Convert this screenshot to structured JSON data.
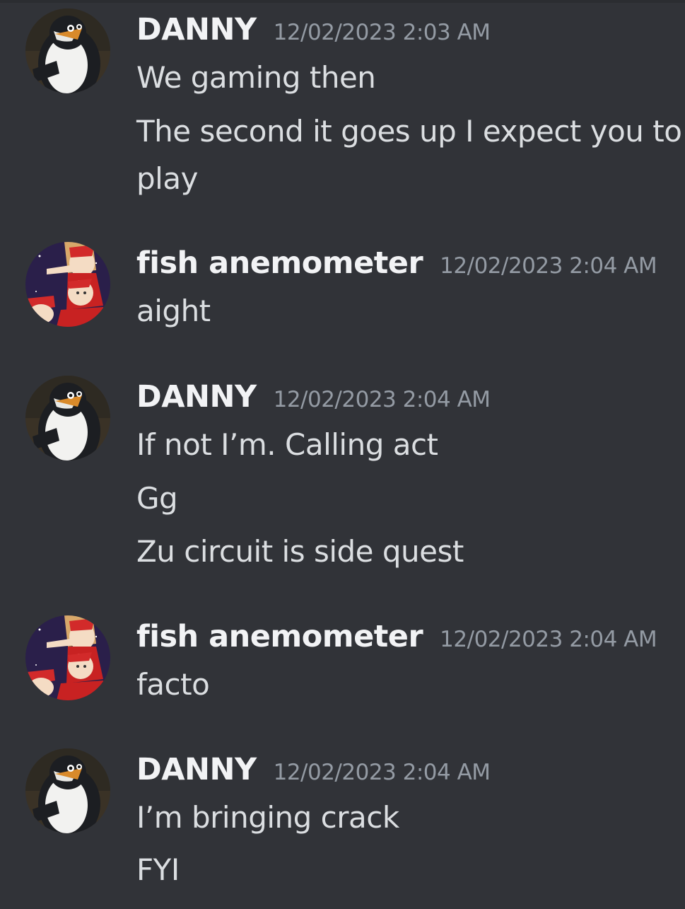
{
  "messages": [
    {
      "author": "DANNY",
      "avatar": "penguin-avatar",
      "timestamp": "12/02/2023 2:03 AM",
      "lines": [
        "We gaming then",
        "The second it goes up I expect you to",
        "play"
      ]
    },
    {
      "author": "fish anemometer",
      "avatar": "anime-santa-avatar",
      "timestamp": "12/02/2023 2:04 AM",
      "lines": [
        "aight"
      ]
    },
    {
      "author": "DANNY",
      "avatar": "penguin-avatar",
      "timestamp": "12/02/2023 2:04 AM",
      "lines": [
        "If not I’m. Calling act",
        "Gg",
        "Zu circuit is side quest"
      ]
    },
    {
      "author": "fish anemometer",
      "avatar": "anime-santa-avatar",
      "timestamp": "12/02/2023 2:04 AM",
      "lines": [
        "facto"
      ]
    },
    {
      "author": "DANNY",
      "avatar": "penguin-avatar",
      "timestamp": "12/02/2023 2:04 AM",
      "lines": [
        "I’m bringing crack",
        "FYI"
      ]
    }
  ],
  "colors": {
    "background": "#313338",
    "username": "#f2f3f5",
    "timestamp": "#949ba4",
    "text": "#dbdee1"
  }
}
